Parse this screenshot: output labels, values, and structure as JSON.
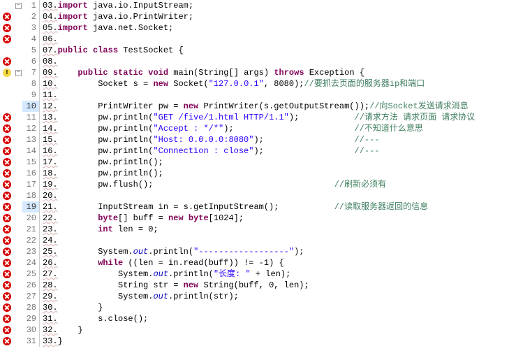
{
  "lines": [
    {
      "num": "1",
      "marker": "",
      "fold": "minus",
      "intro": "03.",
      "tokens": [
        {
          "c": "keyword",
          "t": "import"
        },
        {
          "c": "plain",
          "t": " java.io.InputStream;"
        }
      ]
    },
    {
      "num": "2",
      "marker": "error",
      "fold": "",
      "intro": "04.",
      "tokens": [
        {
          "c": "keyword",
          "t": "import"
        },
        {
          "c": "plain",
          "t": " java.io.PrintWriter;"
        }
      ]
    },
    {
      "num": "3",
      "marker": "error",
      "fold": "",
      "intro": "05.",
      "tokens": [
        {
          "c": "keyword",
          "t": "import"
        },
        {
          "c": "plain",
          "t": " java.net.Socket;"
        }
      ]
    },
    {
      "num": "4",
      "marker": "error",
      "fold": "",
      "intro": "06.",
      "tokens": []
    },
    {
      "num": "5",
      "marker": "",
      "fold": "",
      "intro": "07.",
      "tokens": [
        {
          "c": "keyword",
          "t": "public"
        },
        {
          "c": "plain",
          "t": " "
        },
        {
          "c": "keyword",
          "t": "class"
        },
        {
          "c": "plain",
          "t": " TestSocket {"
        }
      ]
    },
    {
      "num": "6",
      "marker": "error",
      "fold": "",
      "intro": "08.",
      "tokens": []
    },
    {
      "num": "7",
      "marker": "warn",
      "fold": "minus",
      "intro": "09.",
      "tokens": [
        {
          "c": "plain",
          "t": "    "
        },
        {
          "c": "keyword",
          "t": "public"
        },
        {
          "c": "plain",
          "t": " "
        },
        {
          "c": "keyword",
          "t": "static"
        },
        {
          "c": "plain",
          "t": " "
        },
        {
          "c": "keyword",
          "t": "void"
        },
        {
          "c": "plain",
          "t": " main(String[] args) "
        },
        {
          "c": "keyword",
          "t": "throws"
        },
        {
          "c": "plain",
          "t": " Exception {"
        }
      ]
    },
    {
      "num": "8",
      "marker": "",
      "fold": "",
      "intro": "10.",
      "tokens": [
        {
          "c": "plain",
          "t": "        Socket s = "
        },
        {
          "c": "keyword",
          "t": "new"
        },
        {
          "c": "plain",
          "t": " Socket("
        },
        {
          "c": "string",
          "t": "\"127.0.0.1\""
        },
        {
          "c": "plain",
          "t": ", 8080);"
        },
        {
          "c": "comment",
          "t": "//要抓去页面的服务器ip和端口"
        }
      ]
    },
    {
      "num": "9",
      "marker": "",
      "fold": "",
      "intro": "11.",
      "tokens": []
    },
    {
      "num": "10",
      "marker": "",
      "fold": "",
      "intro": "12.",
      "hi": true,
      "tokens": [
        {
          "c": "plain",
          "t": "        PrintWriter pw = "
        },
        {
          "c": "keyword",
          "t": "new"
        },
        {
          "c": "plain",
          "t": " PrintWriter(s.getOutputStream());"
        },
        {
          "c": "comment",
          "t": "//向Socket发送请求消息"
        }
      ]
    },
    {
      "num": "11",
      "marker": "error",
      "fold": "",
      "intro": "13.",
      "tokens": [
        {
          "c": "plain",
          "t": "        pw.println("
        },
        {
          "c": "string",
          "t": "\"GET /five/1.html HTTP/1.1\""
        },
        {
          "c": "plain",
          "t": ");           "
        },
        {
          "c": "comment",
          "t": "//请求方法 请求页面 请求协议"
        }
      ]
    },
    {
      "num": "12",
      "marker": "error",
      "fold": "",
      "intro": "14.",
      "tokens": [
        {
          "c": "plain",
          "t": "        pw.println("
        },
        {
          "c": "string",
          "t": "\"Accept : */*\""
        },
        {
          "c": "plain",
          "t": ");                        "
        },
        {
          "c": "comment",
          "t": "//不知道什么意思"
        }
      ]
    },
    {
      "num": "13",
      "marker": "error",
      "fold": "",
      "intro": "15.",
      "tokens": [
        {
          "c": "plain",
          "t": "        pw.println("
        },
        {
          "c": "string",
          "t": "\"Host: 0.0.0.0:8080\""
        },
        {
          "c": "plain",
          "t": ");                  "
        },
        {
          "c": "comment",
          "t": "//---"
        }
      ]
    },
    {
      "num": "14",
      "marker": "error",
      "fold": "",
      "intro": "16.",
      "tokens": [
        {
          "c": "plain",
          "t": "        pw.println("
        },
        {
          "c": "string",
          "t": "\"Connection : close\""
        },
        {
          "c": "plain",
          "t": ");                  "
        },
        {
          "c": "comment",
          "t": "//---"
        }
      ]
    },
    {
      "num": "15",
      "marker": "error",
      "fold": "",
      "intro": "17.",
      "tokens": [
        {
          "c": "plain",
          "t": "        pw.println();"
        }
      ]
    },
    {
      "num": "16",
      "marker": "error",
      "fold": "",
      "intro": "18.",
      "tokens": [
        {
          "c": "plain",
          "t": "        pw.println();"
        }
      ]
    },
    {
      "num": "17",
      "marker": "error",
      "fold": "",
      "intro": "19.",
      "tokens": [
        {
          "c": "plain",
          "t": "        pw.flush();                                    "
        },
        {
          "c": "comment",
          "t": "//刷新必须有"
        }
      ]
    },
    {
      "num": "18",
      "marker": "error",
      "fold": "",
      "intro": "20.",
      "tokens": []
    },
    {
      "num": "19",
      "marker": "error",
      "fold": "",
      "intro": "21.",
      "hi": true,
      "tokens": [
        {
          "c": "plain",
          "t": "        InputStream in = s.getInputStream();           "
        },
        {
          "c": "comment",
          "t": "//读取服务器返回的信息"
        }
      ]
    },
    {
      "num": "20",
      "marker": "error",
      "fold": "",
      "intro": "22.",
      "tokens": [
        {
          "c": "plain",
          "t": "        "
        },
        {
          "c": "keyword",
          "t": "byte"
        },
        {
          "c": "plain",
          "t": "[] buff = "
        },
        {
          "c": "keyword",
          "t": "new"
        },
        {
          "c": "plain",
          "t": " "
        },
        {
          "c": "keyword",
          "t": "byte"
        },
        {
          "c": "plain",
          "t": "[1024];"
        }
      ]
    },
    {
      "num": "21",
      "marker": "error",
      "fold": "",
      "intro": "23.",
      "tokens": [
        {
          "c": "plain",
          "t": "        "
        },
        {
          "c": "keyword",
          "t": "int"
        },
        {
          "c": "plain",
          "t": " len = 0;"
        }
      ]
    },
    {
      "num": "22",
      "marker": "error",
      "fold": "",
      "intro": "24.",
      "tokens": []
    },
    {
      "num": "23",
      "marker": "error",
      "fold": "",
      "intro": "25.",
      "tokens": [
        {
          "c": "plain",
          "t": "        System."
        },
        {
          "c": "field",
          "t": "out"
        },
        {
          "c": "plain",
          "t": ".println("
        },
        {
          "c": "string",
          "t": "\"------------------\""
        },
        {
          "c": "plain",
          "t": ");"
        }
      ]
    },
    {
      "num": "24",
      "marker": "error",
      "fold": "",
      "intro": "26.",
      "tokens": [
        {
          "c": "plain",
          "t": "        "
        },
        {
          "c": "keyword",
          "t": "while"
        },
        {
          "c": "plain",
          "t": " ((len = in.read(buff)) != -1) {"
        }
      ]
    },
    {
      "num": "25",
      "marker": "error",
      "fold": "",
      "intro": "27.",
      "tokens": [
        {
          "c": "plain",
          "t": "            System."
        },
        {
          "c": "field",
          "t": "out"
        },
        {
          "c": "plain",
          "t": ".println("
        },
        {
          "c": "string",
          "t": "\"长度: \""
        },
        {
          "c": "plain",
          "t": " + len);"
        }
      ]
    },
    {
      "num": "26",
      "marker": "error",
      "fold": "",
      "intro": "28.",
      "tokens": [
        {
          "c": "plain",
          "t": "            String str = "
        },
        {
          "c": "keyword",
          "t": "new"
        },
        {
          "c": "plain",
          "t": " String(buff, 0, len);"
        }
      ]
    },
    {
      "num": "27",
      "marker": "error",
      "fold": "",
      "intro": "29.",
      "tokens": [
        {
          "c": "plain",
          "t": "            System."
        },
        {
          "c": "field",
          "t": "out"
        },
        {
          "c": "plain",
          "t": ".println(str);"
        }
      ]
    },
    {
      "num": "28",
      "marker": "error",
      "fold": "",
      "intro": "30.",
      "tokens": [
        {
          "c": "plain",
          "t": "        }"
        }
      ]
    },
    {
      "num": "29",
      "marker": "error",
      "fold": "",
      "intro": "31.",
      "tokens": [
        {
          "c": "plain",
          "t": "        s.close();"
        }
      ]
    },
    {
      "num": "30",
      "marker": "error",
      "fold": "",
      "intro": "32.",
      "tokens": [
        {
          "c": "plain",
          "t": "    }"
        }
      ]
    },
    {
      "num": "31",
      "marker": "error",
      "fold": "",
      "intro": "33.",
      "tokens": [
        {
          "c": "plain",
          "t": "}"
        }
      ]
    }
  ]
}
